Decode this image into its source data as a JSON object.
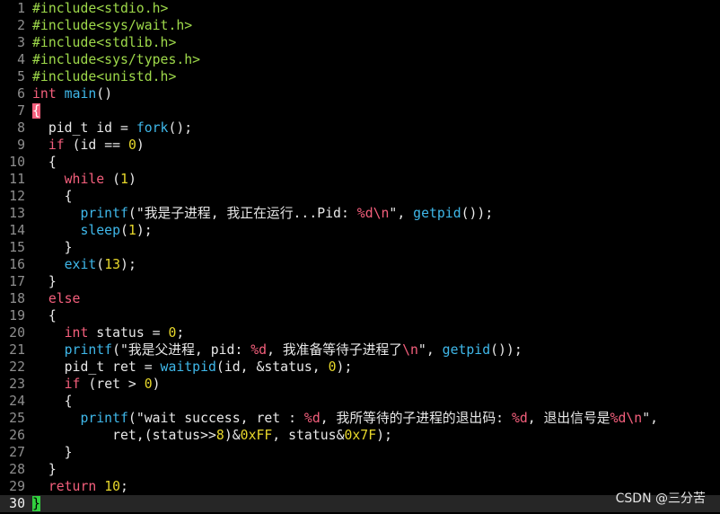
{
  "colors": {
    "background": "#000000",
    "default_text": "#e8e8e8",
    "line_number": "#8e8e8e",
    "current_line_bg": "#262626",
    "preprocessor": "#9ed94a",
    "keyword": "#f45f7c",
    "function": "#3fb8ea",
    "number": "#e8d82b",
    "string": "#e8e8e8",
    "escape_format": "#f45f7c",
    "bracket_match_open": "#f45f7c",
    "bracket_match_close": "#32d13f"
  },
  "editor": {
    "current_line": 30,
    "lines": [
      {
        "num": "1",
        "tokens": [
          {
            "t": "#include<stdio.h>",
            "c": "pre"
          }
        ]
      },
      {
        "num": "2",
        "tokens": [
          {
            "t": "#include<sys/wait.h>",
            "c": "pre"
          }
        ]
      },
      {
        "num": "3",
        "tokens": [
          {
            "t": "#include<stdlib.h>",
            "c": "pre"
          }
        ]
      },
      {
        "num": "4",
        "tokens": [
          {
            "t": "#include<sys/types.h>",
            "c": "pre"
          }
        ]
      },
      {
        "num": "5",
        "tokens": [
          {
            "t": "#include<unistd.h>",
            "c": "pre"
          }
        ]
      },
      {
        "num": "6",
        "tokens": [
          {
            "t": "int",
            "c": "kw"
          },
          {
            "t": " ",
            "c": "txt"
          },
          {
            "t": "main",
            "c": "fn"
          },
          {
            "t": "()",
            "c": "txt"
          }
        ]
      },
      {
        "num": "7",
        "tokens": [
          {
            "t": "{",
            "c": "brace_open"
          }
        ]
      },
      {
        "num": "8",
        "tokens": [
          {
            "t": "  pid_t id = ",
            "c": "txt"
          },
          {
            "t": "fork",
            "c": "fn"
          },
          {
            "t": "();",
            "c": "txt"
          }
        ]
      },
      {
        "num": "9",
        "tokens": [
          {
            "t": "  ",
            "c": "txt"
          },
          {
            "t": "if",
            "c": "kw"
          },
          {
            "t": " (id == ",
            "c": "txt"
          },
          {
            "t": "0",
            "c": "num"
          },
          {
            "t": ")",
            "c": "txt"
          }
        ]
      },
      {
        "num": "10",
        "tokens": [
          {
            "t": "  {",
            "c": "txt"
          }
        ]
      },
      {
        "num": "11",
        "tokens": [
          {
            "t": "    ",
            "c": "txt"
          },
          {
            "t": "while",
            "c": "kw"
          },
          {
            "t": " (",
            "c": "txt"
          },
          {
            "t": "1",
            "c": "num"
          },
          {
            "t": ")",
            "c": "txt"
          }
        ]
      },
      {
        "num": "12",
        "tokens": [
          {
            "t": "    {",
            "c": "txt"
          }
        ]
      },
      {
        "num": "13",
        "tokens": [
          {
            "t": "      ",
            "c": "txt"
          },
          {
            "t": "printf",
            "c": "fn"
          },
          {
            "t": "(\"我是子进程, 我正在运行...Pid: ",
            "c": "str"
          },
          {
            "t": "%d\\n",
            "c": "esc"
          },
          {
            "t": "\", ",
            "c": "str"
          },
          {
            "t": "getpid",
            "c": "fn"
          },
          {
            "t": "());",
            "c": "txt"
          }
        ]
      },
      {
        "num": "14",
        "tokens": [
          {
            "t": "      ",
            "c": "txt"
          },
          {
            "t": "sleep",
            "c": "fn"
          },
          {
            "t": "(",
            "c": "txt"
          },
          {
            "t": "1",
            "c": "num"
          },
          {
            "t": ");",
            "c": "txt"
          }
        ]
      },
      {
        "num": "15",
        "tokens": [
          {
            "t": "    }",
            "c": "txt"
          }
        ]
      },
      {
        "num": "16",
        "tokens": [
          {
            "t": "    ",
            "c": "txt"
          },
          {
            "t": "exit",
            "c": "fn"
          },
          {
            "t": "(",
            "c": "txt"
          },
          {
            "t": "13",
            "c": "num"
          },
          {
            "t": ");",
            "c": "txt"
          }
        ]
      },
      {
        "num": "17",
        "tokens": [
          {
            "t": "  }",
            "c": "txt"
          }
        ]
      },
      {
        "num": "18",
        "tokens": [
          {
            "t": "  ",
            "c": "txt"
          },
          {
            "t": "else",
            "c": "kw"
          }
        ]
      },
      {
        "num": "19",
        "tokens": [
          {
            "t": "  {",
            "c": "txt"
          }
        ]
      },
      {
        "num": "20",
        "tokens": [
          {
            "t": "    ",
            "c": "txt"
          },
          {
            "t": "int",
            "c": "kw"
          },
          {
            "t": " status = ",
            "c": "txt"
          },
          {
            "t": "0",
            "c": "num"
          },
          {
            "t": ";",
            "c": "txt"
          }
        ]
      },
      {
        "num": "21",
        "tokens": [
          {
            "t": "    ",
            "c": "txt"
          },
          {
            "t": "printf",
            "c": "fn"
          },
          {
            "t": "(\"我是父进程, pid: ",
            "c": "str"
          },
          {
            "t": "%d",
            "c": "esc"
          },
          {
            "t": ", 我准备等待子进程了",
            "c": "str"
          },
          {
            "t": "\\n",
            "c": "esc"
          },
          {
            "t": "\", ",
            "c": "str"
          },
          {
            "t": "getpid",
            "c": "fn"
          },
          {
            "t": "());",
            "c": "txt"
          }
        ]
      },
      {
        "num": "22",
        "tokens": [
          {
            "t": "    pid_t ret = ",
            "c": "txt"
          },
          {
            "t": "waitpid",
            "c": "fn"
          },
          {
            "t": "(id, &status, ",
            "c": "txt"
          },
          {
            "t": "0",
            "c": "num"
          },
          {
            "t": ");",
            "c": "txt"
          }
        ]
      },
      {
        "num": "23",
        "tokens": [
          {
            "t": "    ",
            "c": "txt"
          },
          {
            "t": "if",
            "c": "kw"
          },
          {
            "t": " (ret > ",
            "c": "txt"
          },
          {
            "t": "0",
            "c": "num"
          },
          {
            "t": ")",
            "c": "txt"
          }
        ]
      },
      {
        "num": "24",
        "tokens": [
          {
            "t": "    {",
            "c": "txt"
          }
        ]
      },
      {
        "num": "25",
        "tokens": [
          {
            "t": "      ",
            "c": "txt"
          },
          {
            "t": "printf",
            "c": "fn"
          },
          {
            "t": "(\"wait success, ret : ",
            "c": "str"
          },
          {
            "t": "%d",
            "c": "esc"
          },
          {
            "t": ", 我所等待的子进程的退出码: ",
            "c": "str"
          },
          {
            "t": "%d",
            "c": "esc"
          },
          {
            "t": ", 退出信号是",
            "c": "str"
          },
          {
            "t": "%d\\n",
            "c": "esc"
          },
          {
            "t": "\",",
            "c": "str"
          }
        ]
      },
      {
        "num": "26",
        "tokens": [
          {
            "t": "          ret,(status>>",
            "c": "txt"
          },
          {
            "t": "8",
            "c": "num"
          },
          {
            "t": ")&",
            "c": "txt"
          },
          {
            "t": "0xFF",
            "c": "num"
          },
          {
            "t": ", status&",
            "c": "txt"
          },
          {
            "t": "0x7F",
            "c": "num"
          },
          {
            "t": ");",
            "c": "txt"
          }
        ]
      },
      {
        "num": "27",
        "tokens": [
          {
            "t": "    }",
            "c": "txt"
          }
        ]
      },
      {
        "num": "28",
        "tokens": [
          {
            "t": "  }",
            "c": "txt"
          }
        ]
      },
      {
        "num": "29",
        "tokens": [
          {
            "t": "  ",
            "c": "txt"
          },
          {
            "t": "return",
            "c": "kw"
          },
          {
            "t": " ",
            "c": "txt"
          },
          {
            "t": "10",
            "c": "num"
          },
          {
            "t": ";",
            "c": "txt"
          }
        ]
      },
      {
        "num": "30",
        "tokens": [
          {
            "t": "}",
            "c": "brace_close"
          }
        ]
      }
    ]
  },
  "watermark": {
    "text": "CSDN @三分苦"
  }
}
